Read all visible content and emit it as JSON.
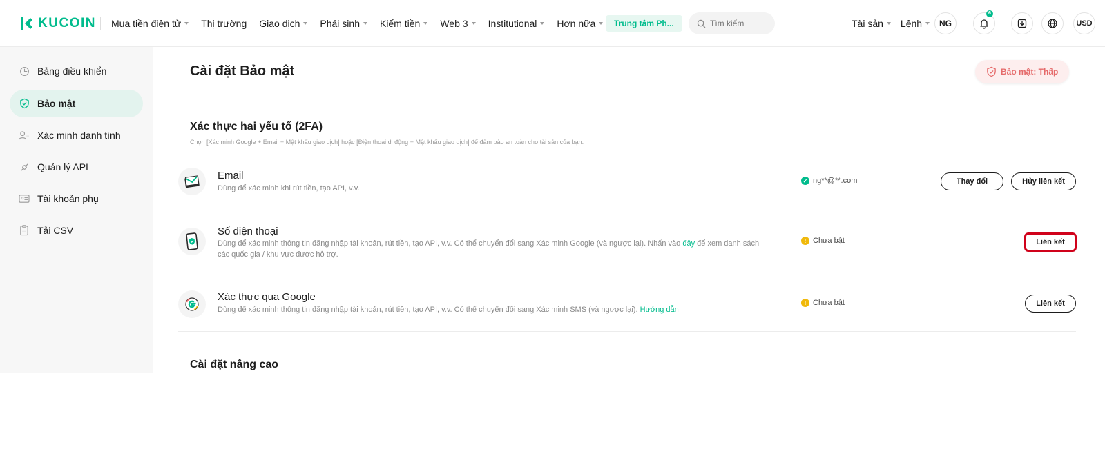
{
  "brand": {
    "name": "KUCOIN",
    "accent": "#01bc8d"
  },
  "topnav": {
    "items": [
      {
        "label": "Mua tiền điện tử",
        "dropdown": true
      },
      {
        "label": "Thị trường",
        "dropdown": false
      },
      {
        "label": "Giao dịch",
        "dropdown": true
      },
      {
        "label": "Phái sinh",
        "dropdown": true
      },
      {
        "label": "Kiếm tiền",
        "dropdown": true
      },
      {
        "label": "Web 3",
        "dropdown": true
      },
      {
        "label": "Institutional",
        "dropdown": true
      },
      {
        "label": "Hơn nữa",
        "dropdown": true
      }
    ],
    "promo": "Trung tâm Ph...",
    "search_placeholder": "Tìm kiếm",
    "assets": "Tài sản",
    "orders": "Lệnh",
    "avatar": "NG",
    "notifications_count": "6",
    "currency": "USD"
  },
  "sidebar": {
    "items": [
      {
        "label": "Bảng điều khiển",
        "icon": "dashboard-icon",
        "active": false
      },
      {
        "label": "Bảo mật",
        "icon": "shield-icon",
        "active": true
      },
      {
        "label": "Xác minh danh tính",
        "icon": "user-verify-icon",
        "active": false
      },
      {
        "label": "Quản lý API",
        "icon": "api-icon",
        "active": false
      },
      {
        "label": "Tài khoản phụ",
        "icon": "sub-account-icon",
        "active": false
      },
      {
        "label": "Tải CSV",
        "icon": "csv-icon",
        "active": false
      }
    ]
  },
  "page": {
    "title": "Cài đặt Bảo mật",
    "security_level": "Bảo mật: Thấp"
  },
  "twofa": {
    "title": "Xác thực hai yếu tố (2FA)",
    "desc": "Chọn [Xác minh Google + Email + Mật khẩu giao dịch] hoặc [Điện thoại di động + Mật khẩu giao dịch] để đảm bảo an toàn cho tài sản của bạn.",
    "rows": [
      {
        "title": "Email",
        "desc": "Dùng để xác minh khi rút tiền, tạo API, v.v.",
        "status": "ng**@**.com",
        "status_type": "ok",
        "buttons": [
          "Thay đổi",
          "Hủy liên kết"
        ]
      },
      {
        "title": "Số điện thoại",
        "desc_before": "Dùng để xác minh thông tin đăng nhập tài khoản, rút tiền, tạo API, v.v. Có thể chuyển đổi sang Xác minh Google (và ngược lại). Nhấn vào ",
        "desc_link": "đây",
        "desc_after": " để xem danh sách các quốc gia / khu vực được hỗ trợ.",
        "status": "Chưa bật",
        "status_type": "warn",
        "buttons": [
          "Liên kết"
        ]
      },
      {
        "title": "Xác thực qua Google",
        "desc_before": "Dùng để xác minh thông tin đăng nhập tài khoản, rút tiền, tạo API, v.v. Có thể chuyển đổi sang Xác minh SMS (và ngược lại). ",
        "desc_link": "Hướng dẫn",
        "status": "Chưa bật",
        "status_type": "warn",
        "buttons": [
          "Liên kết"
        ]
      }
    ]
  },
  "advanced": {
    "title": "Cài đặt nâng cao"
  }
}
